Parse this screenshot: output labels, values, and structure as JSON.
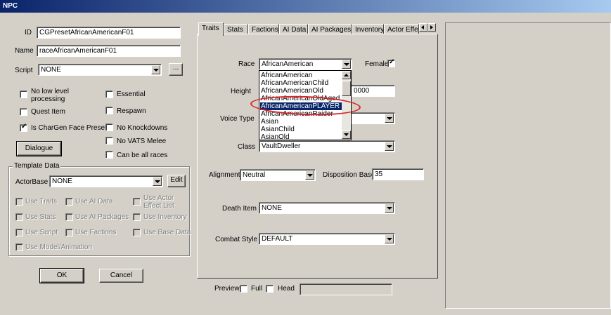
{
  "window": {
    "title": "NPC"
  },
  "left": {
    "id_label": "ID",
    "id_value": "CGPresetAfricanAmericanF01",
    "name_label": "Name",
    "name_value": "raceAfricanAmericanF01",
    "script_label": "Script",
    "script_value": "NONE",
    "script_button": "...",
    "checkboxes": {
      "no_low_level_line1": "No low level",
      "no_low_level_line2": "processing",
      "essential": "Essential",
      "quest_item": "Quest Item",
      "respawn": "Respawn",
      "chargen": "Is CharGen Face Preset",
      "no_knockdowns": "No Knockdowns",
      "no_vats": "No VATS Melee",
      "all_races": "Can be all races"
    },
    "dialogue_button": "Dialogue",
    "template": {
      "title": "Template Data",
      "actorbase_label": "ActorBase",
      "actorbase_value": "NONE",
      "edit_button": "Edit",
      "use_traits": "Use Traits",
      "use_ai_data": "Use AI Data",
      "use_actor_effect_line1": "Use Actor",
      "use_actor_effect_line2": "Effect List",
      "use_stats": "Use Stats",
      "use_ai_packages": "Use AI Packages",
      "use_inventory": "Use Inventory",
      "use_script": "Use Script",
      "use_factions": "Use Factions",
      "use_base_data": "Use Base Data",
      "use_model": "Use Model/Animation"
    },
    "ok_button": "OK",
    "cancel_button": "Cancel"
  },
  "tabs": [
    "Traits",
    "Stats",
    "Factions",
    "AI Data",
    "AI Packages",
    "Inventory",
    "Actor Effe"
  ],
  "traits": {
    "race_label": "Race",
    "race_value": "AfricanAmerican",
    "female_label": "Female",
    "height_label": "Height",
    "height_value": "0000",
    "voice_label": "Voice Type",
    "class_label": "Class",
    "class_value": "VaultDweller",
    "alignment_label": "Alignment",
    "alignment_value": "Neutral",
    "disposition_label": "Disposition Base",
    "disposition_value": "35",
    "death_item_label": "Death Item",
    "death_item_value": "NONE",
    "combat_style_label": "Combat Style",
    "combat_style_value": "DEFAULT"
  },
  "race_dropdown": {
    "items": [
      "AfricanAmerican",
      "AfricanAmericanChild",
      "AfricanAmericanOld",
      "AfricanAmericanOldAged",
      "AfricanAmericanPLAYER",
      "AfricanAmericanRaider",
      "Asian",
      "AsianChild",
      "AsianOld"
    ],
    "selected": "AfricanAmericanPLAYER"
  },
  "preview": {
    "label": "Preview",
    "full_label": "Full",
    "head_label": "Head"
  },
  "colors": {
    "selection": "#0a246a",
    "highlight_circle": "#d6262b",
    "face": "#d4d0c8"
  }
}
